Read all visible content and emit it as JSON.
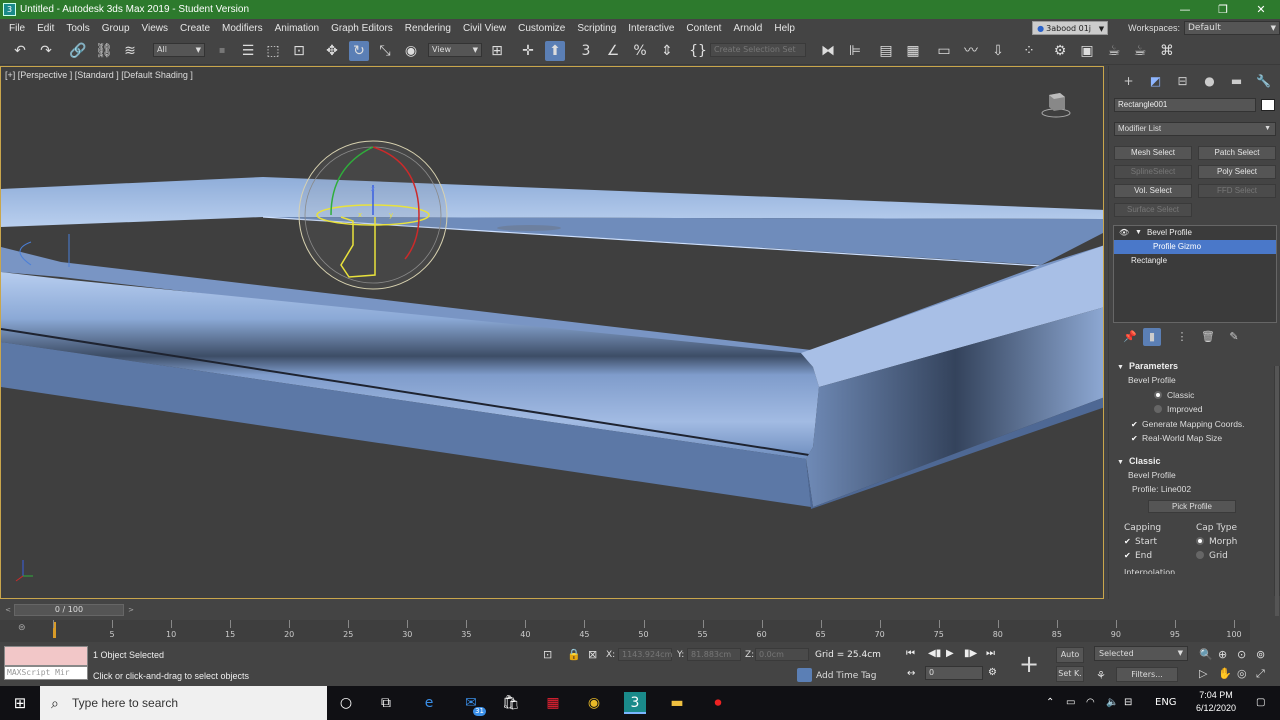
{
  "window": {
    "title": "Untitled - Autodesk 3ds Max 2019 - Student Version",
    "app_icon_label": "3",
    "minimize": "—",
    "maximize": "❐",
    "close": "✕"
  },
  "menu": {
    "items": [
      "File",
      "Edit",
      "Tools",
      "Group",
      "Views",
      "Create",
      "Modifiers",
      "Animation",
      "Graph Editors",
      "Rendering",
      "Civil View",
      "Customize",
      "Scripting",
      "Interactive",
      "Content",
      "Arnold",
      "Help"
    ],
    "user": "3abood 01j",
    "workspaces_label": "Workspaces:",
    "workspace": "Default"
  },
  "toolbar": {
    "selection_filter": "All",
    "ref_coord": "View",
    "named_selection_placeholder": "Create Selection Set",
    "icons": [
      "undo-icon",
      "redo-icon",
      "link-icon",
      "unlink-icon",
      "bind-spacewarp-icon",
      "select-object-icon",
      "select-by-name-icon",
      "rect-region-icon",
      "window-crossing-icon",
      "select-move-icon",
      "select-rotate-icon",
      "select-scale-icon",
      "placement-icon"
    ]
  },
  "viewport": {
    "label": "[+] [Perspective ] [Standard ] [Default Shading ]",
    "colors": {
      "frame": "#c9a64c",
      "object": "#8aa8d8"
    }
  },
  "command_panel": {
    "object_name": "Rectangle001",
    "object_color": "#ffffff",
    "modifier_list": "Modifier List",
    "modifier_buttons": [
      {
        "label": "Mesh Select",
        "enabled": true
      },
      {
        "label": "Patch Select",
        "enabled": true
      },
      {
        "label": "SplineSelect",
        "enabled": false
      },
      {
        "label": "Poly Select",
        "enabled": true
      },
      {
        "label": "Vol. Select",
        "enabled": true
      },
      {
        "label": "FFD Select",
        "enabled": false
      },
      {
        "label": "Surface Select",
        "enabled": false
      }
    ],
    "stack": {
      "modifier": "Bevel Profile",
      "sub_object": "Profile Gizmo",
      "base": "Rectangle"
    },
    "parameters": {
      "title": "Parameters",
      "group": "Bevel Profile",
      "classic": "Classic",
      "improved": "Improved",
      "generate_mapping": "Generate Mapping Coords.",
      "real_world": "Real-World Map Size"
    },
    "classic_rollout": {
      "title": "Classic",
      "group": "Bevel Profile",
      "profile_label": "Profile:",
      "profile_value": "Line002",
      "pick_button": "Pick Profile",
      "capping": "Capping",
      "cap_type": "Cap Type",
      "start": "Start",
      "end": "End",
      "morph": "Morph",
      "grid": "Grid",
      "next_rollout": "Interpolation"
    }
  },
  "time_slider": {
    "position": "0 / 100",
    "current_frame": 0,
    "total_frames": 100,
    "ticks": [
      "0",
      "5",
      "10",
      "15",
      "20",
      "25",
      "30",
      "35",
      "40",
      "45",
      "50",
      "55",
      "60",
      "65",
      "70",
      "75",
      "80",
      "85",
      "90",
      "95",
      "100"
    ]
  },
  "status": {
    "maxscript_placeholder": "MAXScript Mir",
    "selection": "1 Object Selected",
    "prompt": "Click or click-and-drag to select objects",
    "x_label": "X:",
    "x_value": "1143.924cm",
    "y_label": "Y:",
    "y_value": "81.883cm",
    "z_label": "Z:",
    "z_value": "0.0cm",
    "grid": "Grid = 25.4cm",
    "add_time_tag": "Add Time Tag",
    "frame": "0",
    "auto_key": "Auto",
    "set_key": "Set K.",
    "key_filter": "Selected",
    "filters": "Filters..."
  },
  "taskbar": {
    "search_placeholder": "Type here to search",
    "mail_badge": "31",
    "language": "ENG",
    "time": "7:04 PM",
    "date": "6/12/2020"
  }
}
